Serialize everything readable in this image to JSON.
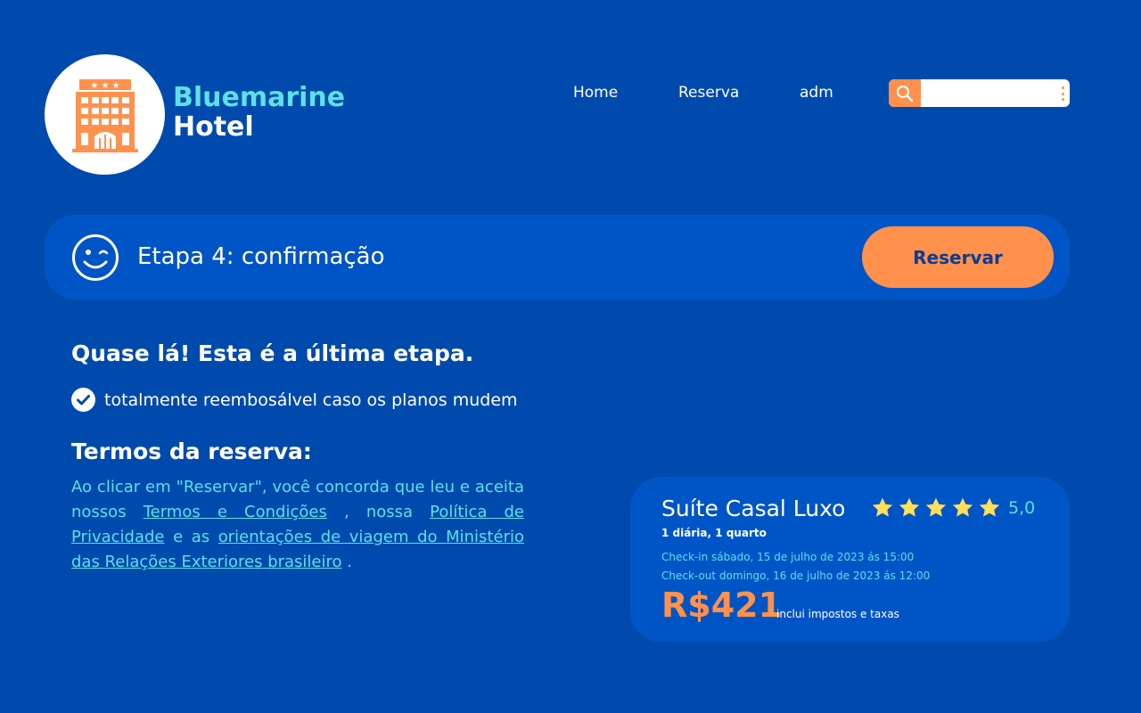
{
  "brand": {
    "line1": "Bluemarine",
    "line2": "Hotel"
  },
  "nav": {
    "home": "Home",
    "reserva": "Reserva",
    "adm": "adm"
  },
  "search": {
    "value": "",
    "placeholder": ""
  },
  "step": {
    "title": "Etapa 4: confirmação",
    "button": "Reservar"
  },
  "main": {
    "heading": "Quase lá! Esta é a última etapa.",
    "refund": "totalmente reembosálvel caso os planos mudem",
    "terms_heading": "Termos da reserva:",
    "terms_p1": "Ao clicar em \"Reservar\", você concorda que leu e aceita nossos ",
    "terms_link1": "Termos e Condições",
    "terms_p2": " , nossa ",
    "terms_link2": "Política de Privacidade",
    "terms_p3": " e as ",
    "terms_link3": "orientações de viagem do Ministério das Relações Exteriores brasileiro",
    "terms_p4": " ."
  },
  "booking": {
    "room": "Suíte Casal Luxo",
    "rating": "5,0",
    "stars": 5,
    "nights": "1 diária, 1 quarto",
    "checkin": "Check-in sábado, 15 de julho de 2023 ás 15:00",
    "checkout": "Check-out domingo, 16 de julho de 2023 ás 12:00",
    "price": "R$421",
    "taxes": "inclui impostos e taxas"
  },
  "colors": {
    "background": "#004aad",
    "panel": "#0055c6",
    "accent": "#ff914d",
    "cyan": "#5ce1e6",
    "star": "#ffde59"
  },
  "icons": {
    "logo": "hotel-building-icon",
    "search": "search-icon",
    "menu": "kebab-menu-icon",
    "step": "wink-smiley-icon",
    "check": "check-circle-icon",
    "star": "star-icon"
  }
}
